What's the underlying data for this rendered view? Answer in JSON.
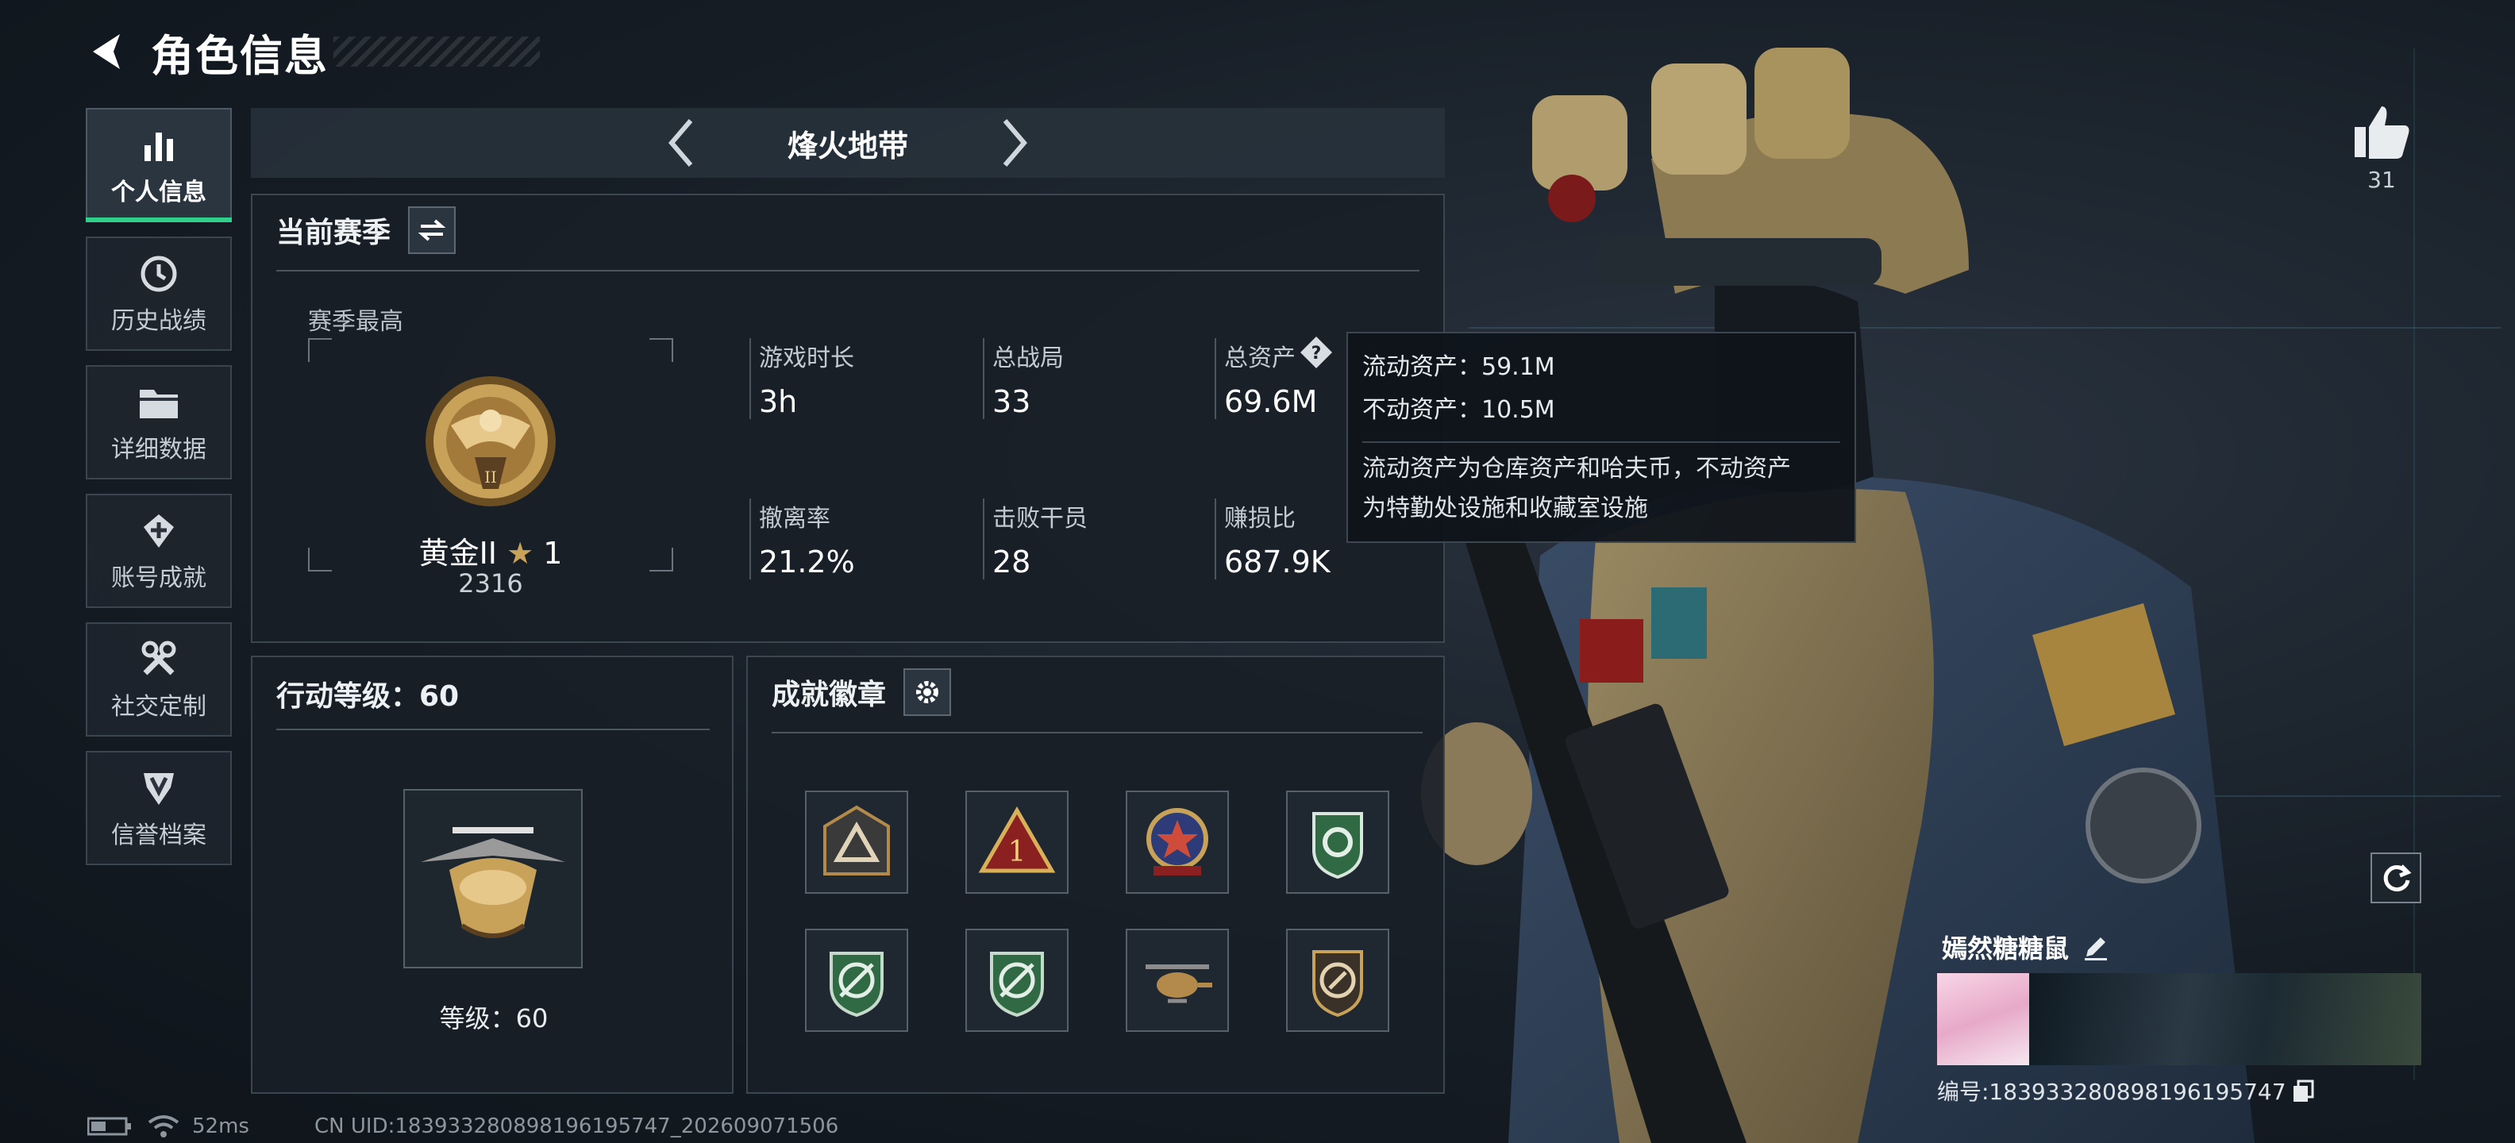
{
  "header": {
    "title": "角色信息"
  },
  "sidebar": {
    "items": [
      {
        "label": "个人信息",
        "icon": "bar-chart-icon",
        "active": true
      },
      {
        "label": "历史战绩",
        "icon": "clock-history-icon",
        "active": false
      },
      {
        "label": "详细数据",
        "icon": "folder-icon",
        "active": false
      },
      {
        "label": "账号成就",
        "icon": "achievement-medal-icon",
        "active": false
      },
      {
        "label": "社交定制",
        "icon": "tools-icon",
        "active": false
      },
      {
        "label": "信誉档案",
        "icon": "shield-emblem-icon",
        "active": false
      }
    ]
  },
  "mode_selector": {
    "name": "烽火地带"
  },
  "season": {
    "title": "当前赛季",
    "best_label": "赛季最高",
    "rank_name": "黄金II",
    "rank_stars": "1",
    "rank_points": "2316",
    "stats": [
      {
        "label": "游戏时长",
        "value": "3h"
      },
      {
        "label": "总战局",
        "value": "33"
      },
      {
        "label": "总资产",
        "value": "69.6M"
      },
      {
        "label": "撤离率",
        "value": "21.2%"
      },
      {
        "label": "击败干员",
        "value": "28"
      },
      {
        "label": "赚损比",
        "value": "687.9K"
      }
    ]
  },
  "tooltip": {
    "liquid": "流动资产：59.1M",
    "fixed": "不动资产：10.5M",
    "desc_line1": "流动资产为仓库资产和哈夫币，不动资产",
    "desc_line2": "为特勤处设施和收藏室设施"
  },
  "level": {
    "title": "行动等级：60",
    "level_text": "等级：60"
  },
  "achievements": {
    "title": "成就徽章",
    "badges": [
      "badge-triangle-dark",
      "badge-triangle-one",
      "badge-star-seal",
      "badge-green-shield",
      "badge-green-crosshair",
      "badge-green-crosshair-2",
      "badge-helicopter",
      "badge-bronze-clock"
    ]
  },
  "likes": {
    "count": "31"
  },
  "profile": {
    "nickname": "嫣然糖糖鼠",
    "id_text": "编号:1839332808981961957​47"
  },
  "status": {
    "ping": "52ms",
    "uid": "CN UID:1839332808981961957​47_202609071506"
  },
  "colors": {
    "accent_green": "#2fd18a",
    "panel_bg": "#181f27",
    "gold": "#c9a25a"
  }
}
